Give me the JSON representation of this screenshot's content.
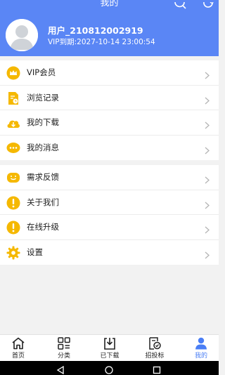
{
  "header": {
    "title": "我的",
    "search_icon": "search-icon",
    "refresh_icon": "refresh-icon",
    "bg_color": "#5a86f5"
  },
  "profile": {
    "username": "用户_210812002919",
    "vip_expiry": "VIP到期:2027-10-14 23:00:54",
    "avatar_icon": "default-avatar-icon"
  },
  "menu_group_1": [
    {
      "label": "VIP会员",
      "icon": "crown-icon"
    },
    {
      "label": "浏览记录",
      "icon": "history-icon"
    },
    {
      "label": "我的下载",
      "icon": "download-icon"
    },
    {
      "label": "我的消息",
      "icon": "message-icon"
    }
  ],
  "menu_group_2": [
    {
      "label": "需求反馈",
      "icon": "feedback-icon"
    },
    {
      "label": "关于我们",
      "icon": "info-icon"
    },
    {
      "label": "在线升级",
      "icon": "upgrade-icon"
    },
    {
      "label": "设置",
      "icon": "gear-icon"
    }
  ],
  "tabbar": {
    "active_color": "#4a7ef5",
    "items": [
      {
        "label": "首页",
        "icon": "home-icon"
      },
      {
        "label": "分类",
        "icon": "category-icon"
      },
      {
        "label": "已下载",
        "icon": "downloaded-icon"
      },
      {
        "label": "招投标",
        "icon": "bidding-icon"
      },
      {
        "label": "我的",
        "icon": "user-icon",
        "active": true
      }
    ]
  },
  "system_nav": [
    "back-icon",
    "home-circle-icon",
    "recents-icon"
  ]
}
